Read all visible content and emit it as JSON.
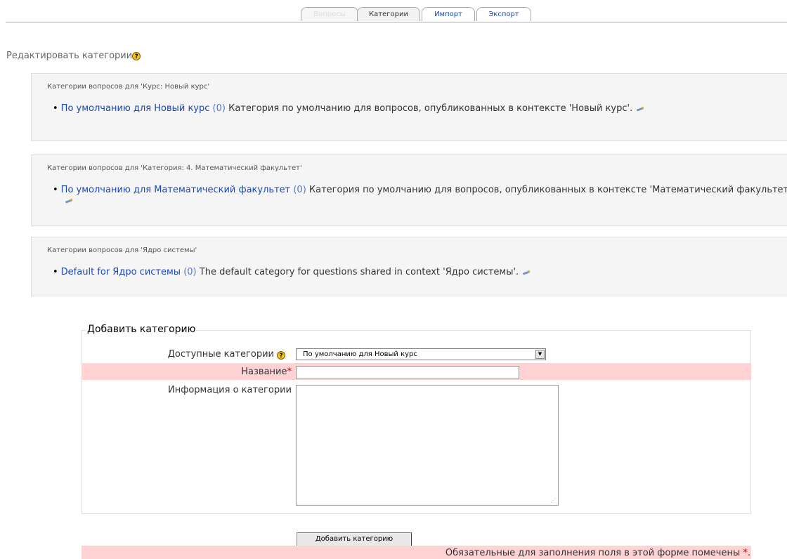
{
  "tabs": [
    {
      "label": "Вопросы",
      "state": "disabled"
    },
    {
      "label": "Категории",
      "state": "selected"
    },
    {
      "label": "Импорт",
      "state": "link"
    },
    {
      "label": "Экспорт",
      "state": "link"
    }
  ],
  "heading": {
    "text": "Редактировать категории",
    "help": "?"
  },
  "contexts": [
    {
      "title": "Категории вопросов для 'Курс: Новый курс'",
      "category": {
        "name": "По умолчанию для Новый курс",
        "count": "(0)",
        "description": " Категория по умолчанию для вопросов, опубликованных в контексте 'Новый курс'."
      }
    },
    {
      "title": "Категории вопросов для 'Категория: 4. Математический факультет'",
      "category": {
        "name": "По умолчанию для Математический факультет",
        "count": "(0)",
        "description": " Категория по умолчанию для вопросов, опубликованных в контексте 'Математический факультет'."
      }
    },
    {
      "title": "Категории вопросов для 'Ядро системы'",
      "category": {
        "name": "Default for Ядро системы",
        "count": "(0)",
        "description": " The default category for questions shared in context 'Ядро системы'."
      }
    }
  ],
  "form": {
    "legend": "Добавить категорию",
    "parent_label": "Доступные категории",
    "parent_value": "По умолчанию для Новый курс",
    "name_label": "Название",
    "name_value": "",
    "info_label": "Информация о категории",
    "info_value": "",
    "required_star": "*",
    "submit_label": "Добавить категорию",
    "required_note": "Обязательные для заполнения поля в этой форме помечены ",
    "required_note_end": "."
  },
  "colors": {
    "link": "#1a48b0",
    "required_band": "#ffd3d3",
    "required_star": "#cc0000"
  }
}
